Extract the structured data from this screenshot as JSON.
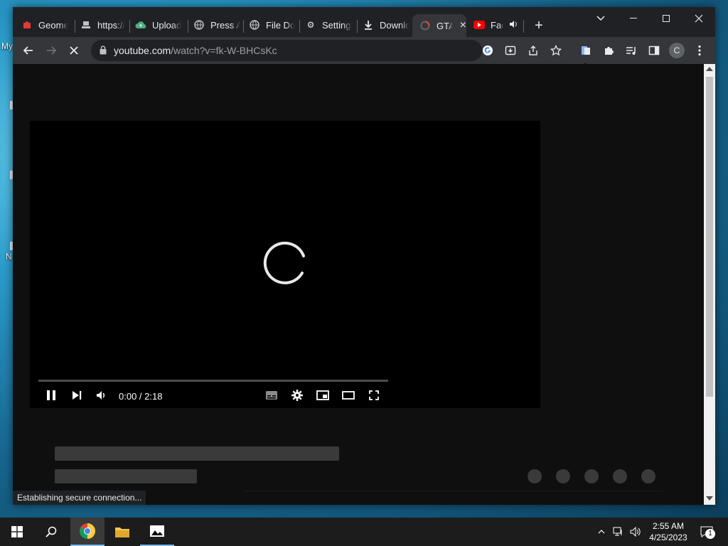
{
  "desktop": {
    "labels": [
      "My",
      "N"
    ]
  },
  "browser": {
    "tabs": [
      {
        "title": "Geometry",
        "icon": "red-puzzle-icon"
      },
      {
        "title": "https://",
        "icon": "stamp-icon"
      },
      {
        "title": "Upload",
        "icon": "cloud-upload-icon"
      },
      {
        "title": "Press A",
        "icon": "globe-icon"
      },
      {
        "title": "File Do",
        "icon": "globe-icon"
      },
      {
        "title": "Settings",
        "icon": "gear-icon"
      },
      {
        "title": "Downlo",
        "icon": "download-icon"
      },
      {
        "title": "GTA",
        "icon": "youtube-loading-icon",
        "active": true
      },
      {
        "title": "Fac",
        "icon": "youtube-icon"
      }
    ],
    "close_tab_label": "×",
    "new_tab_label": "+",
    "address": {
      "domain": "youtube.com",
      "path": "/watch?v=fk-W-BHCsKc"
    },
    "profile_initial": "C",
    "status_text": "Establishing secure connection..."
  },
  "player": {
    "time": "0:00 / 2:18",
    "progress": 0
  },
  "taskbar": {
    "clock_time": "2:55 AM",
    "clock_date": "4/25/2023",
    "notification_count": "1"
  },
  "colors": {
    "accent": "#8ab4f8",
    "youtube_red": "#ff0000",
    "chrome_dark": "#202124"
  }
}
